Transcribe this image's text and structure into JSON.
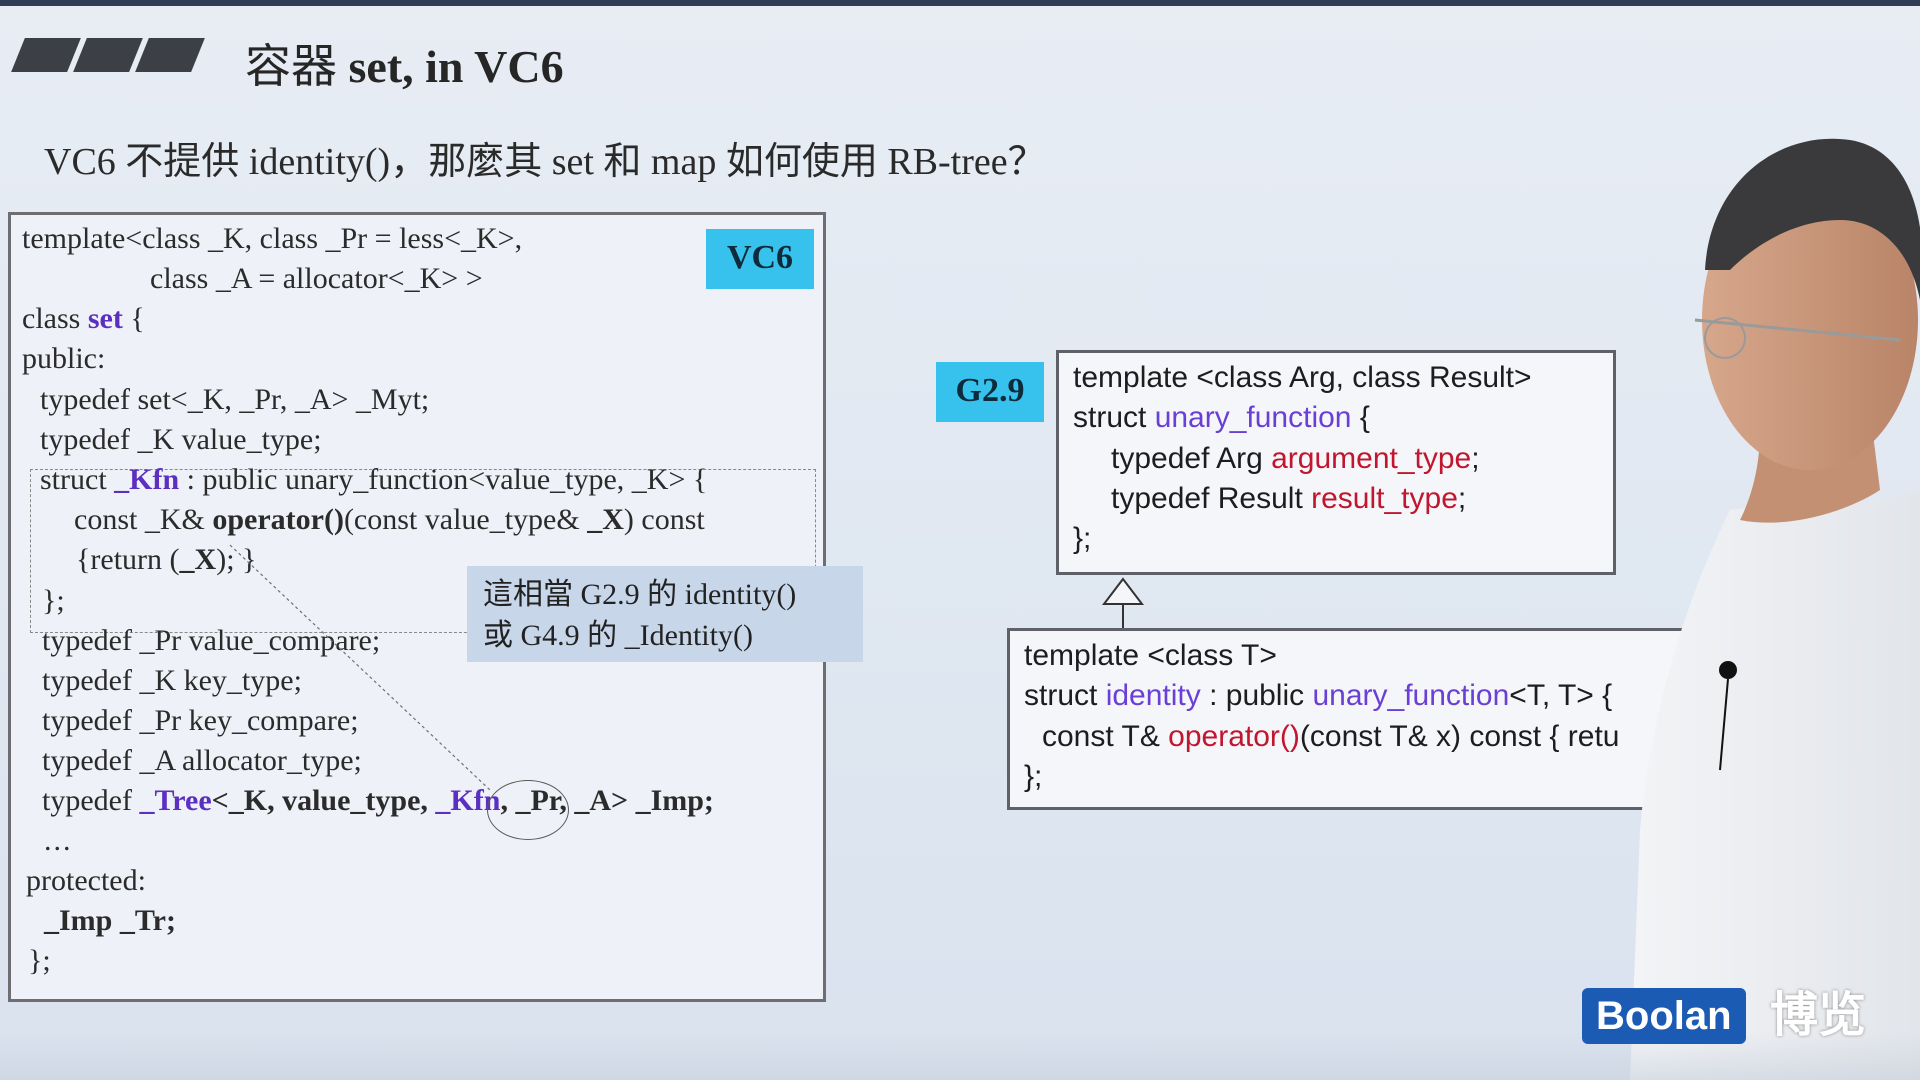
{
  "title": {
    "prefix": "容器",
    "main": " set, in VC6"
  },
  "subtitle": "VC6 不提供 identity()，那麼其 set 和 map 如何使用 RB-tree？",
  "tags": {
    "vc6": "VC6",
    "g29": "G2.9"
  },
  "vc6_code": {
    "l1": "template<class _K, class _Pr = less<_K>,",
    "l2": "class _A = allocator<_K> >",
    "l3_a": "class ",
    "l3_kw": "set",
    "l3_b": " {",
    "l4": "public:",
    "l5": "typedef set<_K, _Pr, _A> _Myt;",
    "l6": "typedef _K value_type;",
    "l7_a": "struct ",
    "l7_kw": "_Kfn",
    "l7_b": " : public unary_function<value_type, _K> {",
    "l8_a": "const _K& ",
    "l8_op": "operator()",
    "l8_b": "(const value_type& ",
    "l8_x": "_X",
    "l8_c": ") const",
    "l9_a": "{return (",
    "l9_x": "_X",
    "l9_b": "); }",
    "l10": "};",
    "l11": "typedef _Pr value_compare;",
    "l12": "typedef _K key_type;",
    "l13": "typedef _Pr key_compare;",
    "l14": "typedef _A allocator_type;",
    "l15_a": "typedef ",
    "l15_tree": "_Tree",
    "l15_b": "<_K, value_type, ",
    "l15_kfn": "_Kfn",
    "l15_c": ", _Pr, _A> _Imp;",
    "l16": "...",
    "l17": "protected:",
    "l18": "_Imp _Tr;",
    "l19": "};"
  },
  "callout": {
    "line1": "這相當 G2.9 的 identity()",
    "line2": "或 G4.9 的 _Identity()"
  },
  "unary_code": {
    "l1": "template <class Arg, class Result>",
    "l2_a": "struct ",
    "l2_kw": "unary_function",
    "l2_b": " {",
    "l3_a": "typedef Arg ",
    "l3_kw": "argument_type",
    "l3_b": ";",
    "l4_a": "typedef Result ",
    "l4_kw": "result_type",
    "l4_b": ";",
    "l5": "};"
  },
  "identity_code": {
    "l1": "template <class T>",
    "l2_a": "struct ",
    "l2_kw": "identity",
    "l2_b": " : public ",
    "l2_kw2": "unary_function",
    "l2_c": "<T, T> {",
    "l3_a": "const T& ",
    "l3_op": "operator()",
    "l3_b": "(const T& x) const { retu",
    "l4": "};"
  },
  "logo": {
    "latin": "Boolan",
    "cjk": "博览"
  },
  "colors": {
    "tag": "#36c2ec",
    "keyword": "#5b2fc0",
    "highlight_red": "#c1162d",
    "logo_blue": "#1c5bb4"
  }
}
